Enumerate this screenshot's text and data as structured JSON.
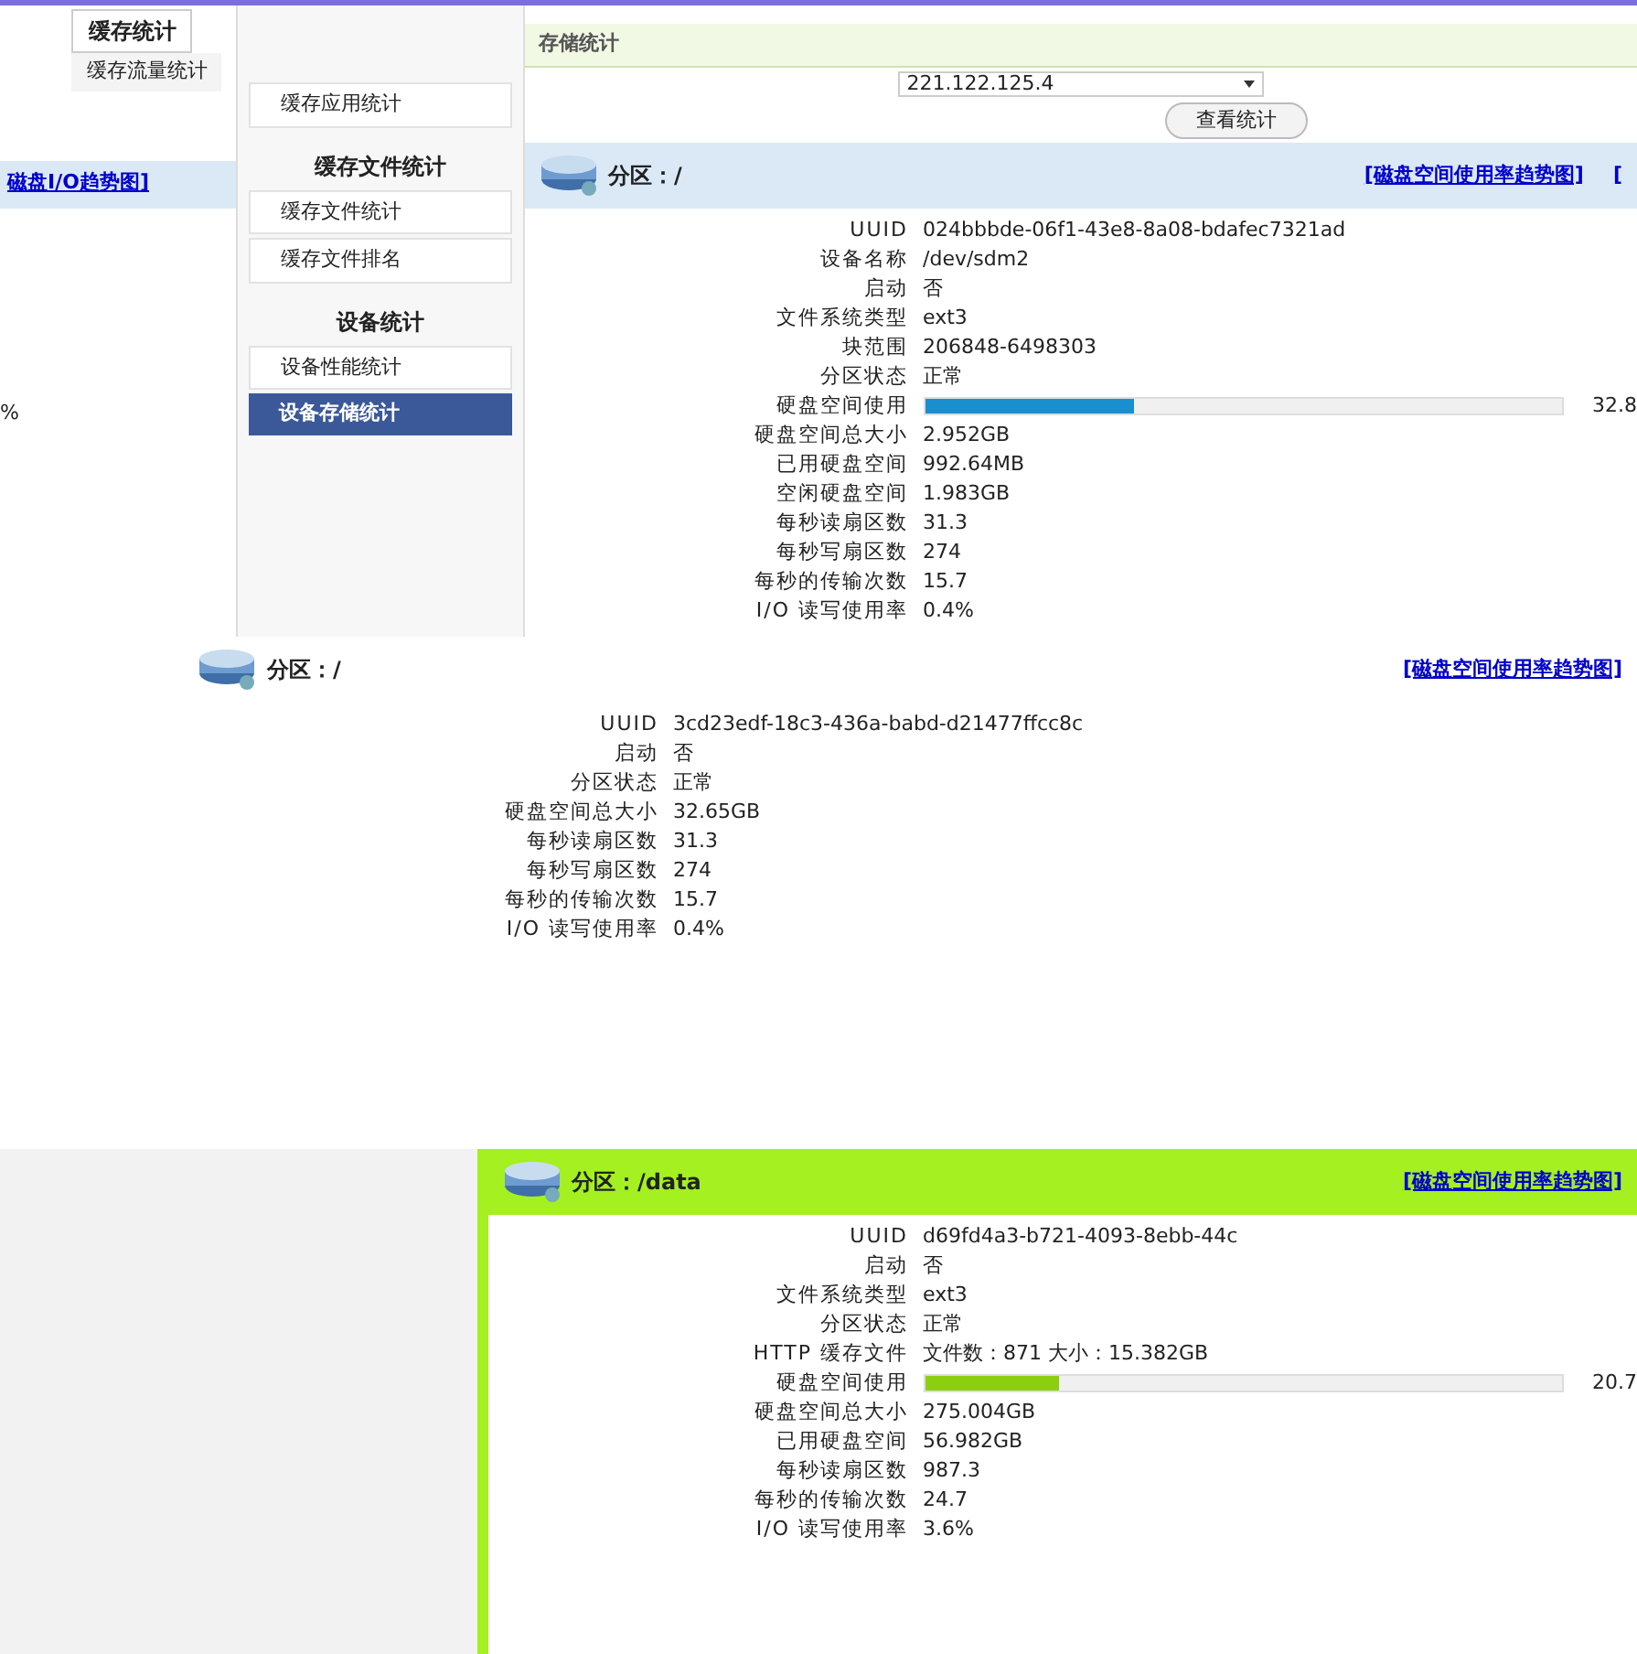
{
  "tabs": [
    {
      "label": "缓存统计",
      "selected": true
    },
    {
      "label": "缓存流量统计",
      "selected": false
    }
  ],
  "section_title": "存储统计",
  "server": {
    "value": "221.122.125.4"
  },
  "query_button": "查看统计",
  "left_fragments": {
    "link": "磁盘I/O趋势图]",
    "percent": "%"
  },
  "sidebar": [
    {
      "kind": "item",
      "label": "缓存应用统计",
      "selected": false
    },
    {
      "kind": "group",
      "label": "缓存文件统计"
    },
    {
      "kind": "item",
      "label": "缓存文件统计",
      "selected": false
    },
    {
      "kind": "item",
      "label": "缓存文件排名",
      "selected": false
    },
    {
      "kind": "group",
      "label": "设备统计"
    },
    {
      "kind": "item",
      "label": "设备性能统计",
      "selected": false
    },
    {
      "kind": "item",
      "label": "设备存储统计",
      "selected": true
    }
  ],
  "partitions": [
    {
      "title": "分区：/",
      "links": [
        "[磁盘空间使用率趋势图]",
        "["
      ],
      "rows": [
        {
          "kind": "text",
          "label": "UUID",
          "value": "024bbbde-06f1-43e8-8a08-bdafec7321ad"
        },
        {
          "kind": "text",
          "label": "设备名称",
          "value": "/dev/sdm2"
        },
        {
          "kind": "text",
          "label": "启动",
          "value": "否"
        },
        {
          "kind": "text",
          "label": "文件系统类型",
          "value": "ext3"
        },
        {
          "kind": "text",
          "label": "块范围",
          "value": "206848-6498303"
        },
        {
          "kind": "text",
          "label": "分区状态",
          "value": "正常"
        },
        {
          "kind": "bar",
          "label": "硬盘空间使用",
          "level": 0.33,
          "value": "32.8"
        },
        {
          "kind": "text",
          "label": "硬盘空间总大小",
          "value": "2.952GB"
        },
        {
          "kind": "text",
          "label": "已用硬盘空间",
          "value": "992.64MB"
        },
        {
          "kind": "text",
          "label": "空闲硬盘空间",
          "value": "1.983GB"
        },
        {
          "kind": "text",
          "label": "每秒读扇区数",
          "value": "31.3"
        },
        {
          "kind": "text",
          "label": "每秒写扇区数",
          "value": "274"
        },
        {
          "kind": "text",
          "label": "每秒的传输次数",
          "value": "15.7"
        },
        {
          "kind": "text",
          "label": "I/O 读写使用率",
          "value": "0.4%"
        }
      ]
    },
    {
      "title": "分区：/",
      "links": [
        "[磁盘空间使用率趋势图]"
      ],
      "rows": [
        {
          "kind": "text",
          "label": "UUID",
          "value": "3cd23edf-18c3-436a-babd-d21477ffcc8c"
        },
        {
          "kind": "text",
          "label": "启动",
          "value": "否"
        },
        {
          "kind": "text",
          "label": "分区状态",
          "value": "正常"
        },
        {
          "kind": "text",
          "label": "硬盘空间总大小",
          "value": "32.65GB"
        },
        {
          "kind": "text",
          "label": "每秒读扇区数",
          "value": "31.3"
        },
        {
          "kind": "text",
          "label": "每秒写扇区数",
          "value": "274"
        },
        {
          "kind": "text",
          "label": "每秒的传输次数",
          "value": "15.7"
        },
        {
          "kind": "text",
          "label": "I/O 读写使用率",
          "value": "0.4%"
        }
      ]
    },
    {
      "title": "分区：/data",
      "links": [
        "[磁盘空间使用率趋势图]"
      ],
      "rows": [
        {
          "kind": "text",
          "label": "UUID",
          "value": "d69fd4a3-b721-4093-8ebb-44c"
        },
        {
          "kind": "text",
          "label": "启动",
          "value": "否"
        },
        {
          "kind": "text",
          "label": "文件系统类型",
          "value": "ext3"
        },
        {
          "kind": "text",
          "label": "分区状态",
          "value": "正常"
        },
        {
          "kind": "text",
          "label": "HTTP 缓存文件",
          "value": "文件数：871  大小：15.382GB"
        },
        {
          "kind": "bar",
          "label": "硬盘空间使用",
          "level": 0.21,
          "value": "20.7"
        },
        {
          "kind": "text",
          "label": "硬盘空间总大小",
          "value": "275.004GB"
        },
        {
          "kind": "text",
          "label": "已用硬盘空间",
          "value": "56.982GB"
        },
        {
          "kind": "text",
          "label": "每秒读扇区数",
          "value": "987.3"
        },
        {
          "kind": "text",
          "label": "每秒的传输次数",
          "value": "24.7"
        },
        {
          "kind": "text",
          "label": "I/O 读写使用率",
          "value": "3.6%"
        }
      ]
    }
  ]
}
